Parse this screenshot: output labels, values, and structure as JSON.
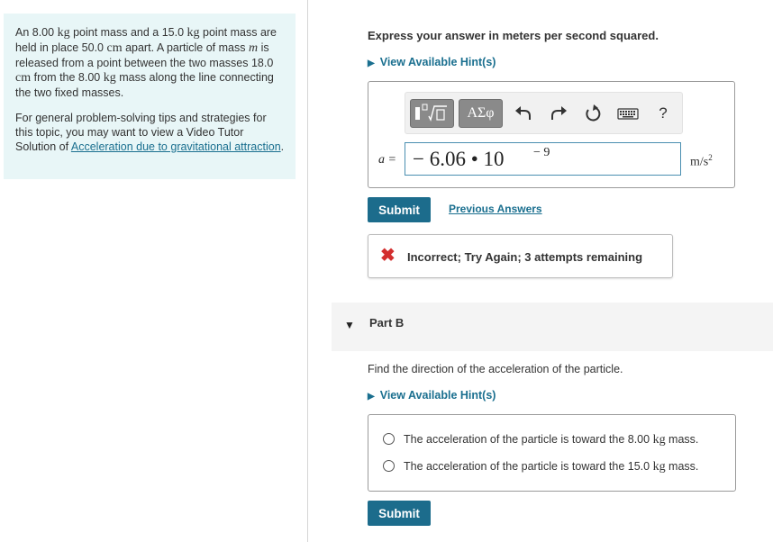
{
  "problem": {
    "p1_a": "An 8.00",
    "unit_kg": "kg",
    "p1_b": "point mass and a 15.0",
    "p1_c": "point mass are held in place 50.0",
    "unit_cm": "cm",
    "p1_d": "apart. A particle of mass",
    "mass_var": "m",
    "p1_e": "is released from a point between the two masses 18.0",
    "p1_f": "from the 8.00",
    "p1_g": "mass along the line connecting the two fixed masses.",
    "p2_text": "For general problem-solving tips and strategies for this topic, you may want to view a Video Tutor Solution of",
    "p2_link": "Acceleration due to gravitational attraction",
    "p2_end": "."
  },
  "part_a": {
    "instruction": "Express your answer in meters per second squared.",
    "hint_label": "View Available Hint(s)",
    "toolbar": {
      "templates_icon": "template-icon",
      "greek_label": "ΑΣφ",
      "undo_icon": "undo-icon",
      "redo_icon": "redo-icon",
      "reset_icon": "reset-icon",
      "keyboard_icon": "keyboard-icon",
      "help_label": "?"
    },
    "answer_label": "a =",
    "answer_value": "− 6.06 • 10",
    "answer_exponent": "− 9",
    "unit": "m/s",
    "unit_exp": "2",
    "submit_label": "Submit",
    "previous_answers_label": "Previous Answers",
    "feedback_text": "Incorrect; Try Again; 3 attempts remaining",
    "feedback_icon": "✖"
  },
  "part_b": {
    "title": "Part B",
    "question": "Find the direction of the acceleration of the particle.",
    "hint_label": "View Available Hint(s)",
    "options": [
      {
        "a": "The acceleration of the particle is toward the 8.00",
        "unit": "kg",
        "b": "mass."
      },
      {
        "a": "The acceleration of the particle is toward the 15.0",
        "unit": "kg",
        "b": "mass."
      }
    ],
    "submit_label": "Submit"
  },
  "colors": {
    "accent": "#1c6c8c",
    "link": "#1a6f8f",
    "problem_bg": "#e8f6f7",
    "error": "#d32f2f"
  }
}
